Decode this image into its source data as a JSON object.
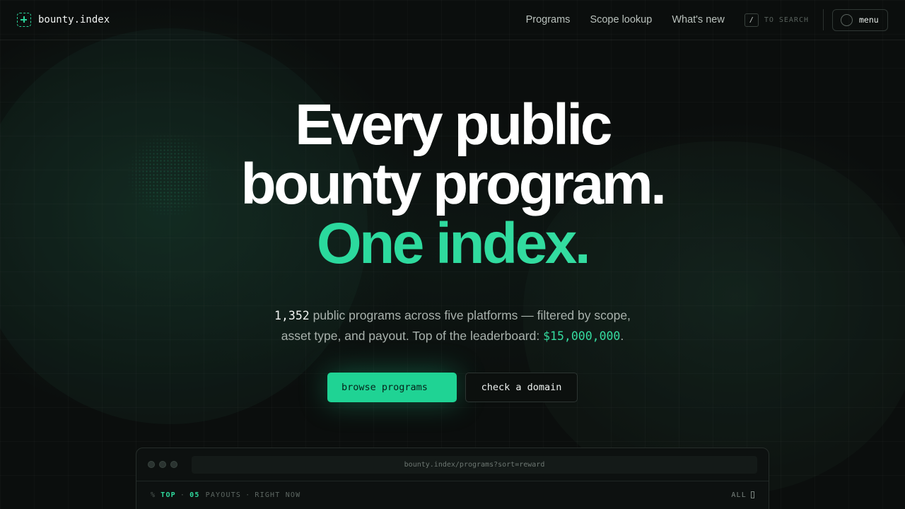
{
  "header": {
    "brand": "bounty.index",
    "nav": [
      "Programs",
      "Scope lookup",
      "What's new"
    ],
    "search_key": "/",
    "search_hint": "TO SEARCH",
    "menu_label": "menu"
  },
  "hero": {
    "line1": "Every public",
    "line2": "bounty program.",
    "line3": "One index.",
    "count": "1,352",
    "sub_a": " public programs across five platforms — filtered by scope,",
    "sub_b": "asset type, and payout. Top of the leaderboard: ",
    "top_payout": "$15,000,000",
    "sub_end": ".",
    "primary_cta": "browse programs",
    "secondary_cta": "check a domain"
  },
  "preview": {
    "url": "bounty.index/programs?sort=reward",
    "prefix": "%",
    "top": "TOP",
    "num": "05",
    "payouts": "PAYOUTS",
    "now": "RIGHT NOW",
    "all": "ALL"
  },
  "colors": {
    "accent": "#1fd394",
    "background": "#0b0e0d"
  },
  "icons": [
    "brand-logo-icon",
    "menu-circle-icon",
    "window-dot-icon"
  ]
}
